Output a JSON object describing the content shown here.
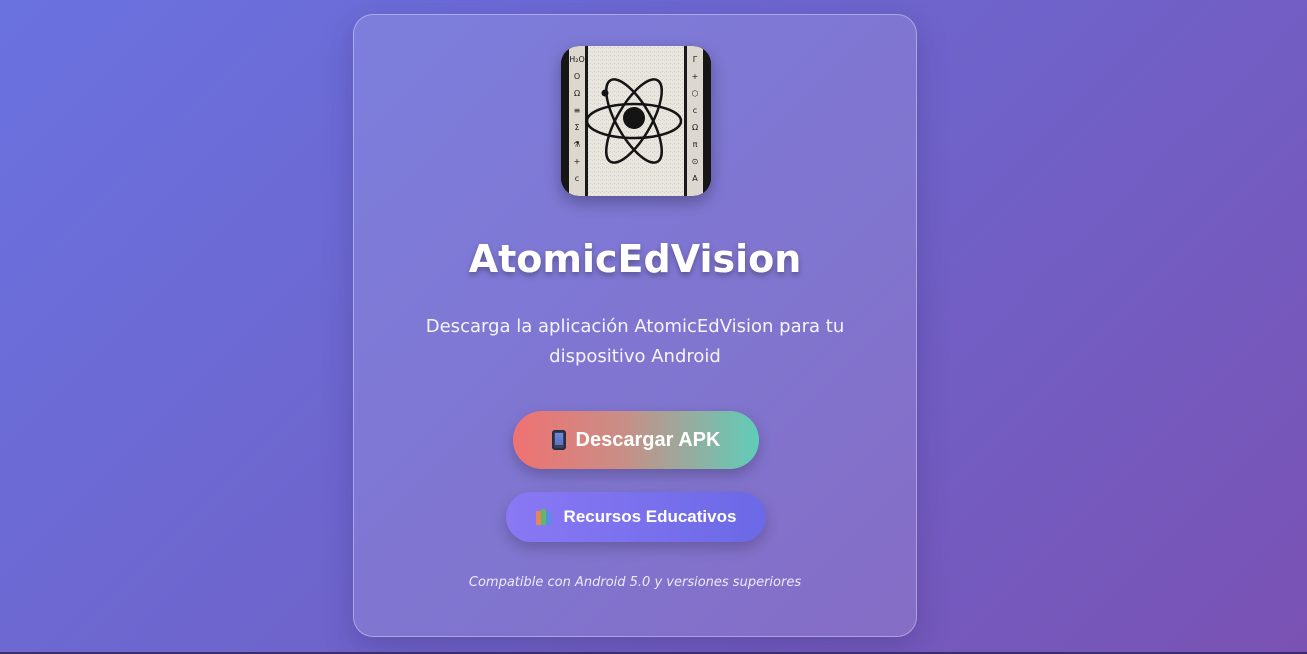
{
  "app": {
    "title": "AtomicEdVision",
    "description": "Descarga la aplicación AtomicEdVision para tu dispositivo Android",
    "compatibility": "Compatible con Android 5.0 y versiones superiores"
  },
  "buttons": {
    "download_apk": {
      "icon": "mobile-phone-icon",
      "label": "Descargar APK"
    },
    "resources": {
      "icon": "books-icon",
      "label": "Recursos Educativos"
    }
  },
  "logo": {
    "icon": "atom-icon",
    "symbols_left": [
      "H₂O",
      "O",
      "Ω",
      "≡",
      "Σ",
      "⚗",
      "+",
      "c"
    ],
    "symbols_right": [
      "Γ",
      "+",
      "⬡",
      "c",
      "Ω",
      "π",
      "⊙",
      "A"
    ]
  },
  "colors": {
    "background_start": "#6a72e0",
    "background_end": "#7a52b4",
    "apk_button_start": "#ef7272",
    "apk_button_end": "#5fcdb8",
    "resources_button_start": "#8a78f4",
    "resources_button_end": "#6b69e6"
  }
}
